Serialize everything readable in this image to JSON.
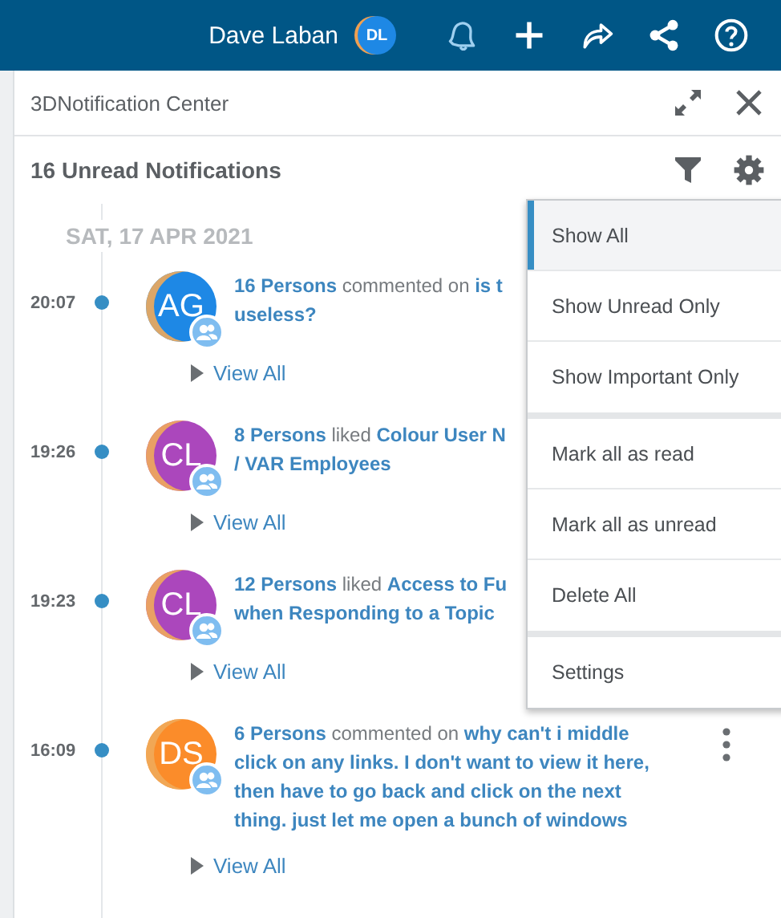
{
  "top_bar": {
    "user_name": "Dave Laban",
    "user_initials": "DL"
  },
  "panel": {
    "title": "3DNotification Center"
  },
  "toolbar": {
    "heading": "16 Unread Notifications"
  },
  "date_heading": "SAT, 17 APR 2021",
  "notifications": [
    {
      "time": "20:07",
      "initials": "AG",
      "color": "#1e88e5",
      "lines": [
        "**16 Persons** commented on **is t**",
        "**useless?**"
      ],
      "view_all": "View All"
    },
    {
      "time": "19:26",
      "initials": "CL",
      "color": "#ab47bc",
      "lines": [
        "**8 Persons** liked **Colour User N**",
        "**/ VAR Employees**"
      ],
      "view_all": "View All"
    },
    {
      "time": "19:23",
      "initials": "CL",
      "color": "#ab47bc",
      "lines": [
        "**12 Persons** liked **Access to Fu**",
        "**when Responding to a Topic**"
      ],
      "view_all": "View All"
    },
    {
      "time": "16:09",
      "initials": "DS",
      "color": "#fb8c2a",
      "lines": [
        "**6 Persons** commented on **why can't i middle**",
        "**click on any links. I don't want to view it here,**",
        "**then have to go back and click on the next**",
        "**thing. just let me open a bunch of windows**"
      ],
      "view_all": "View All",
      "show_more": true
    }
  ],
  "menu": {
    "groups": [
      [
        {
          "label": "Show All",
          "selected": true
        },
        {
          "label": "Show Unread Only",
          "selected": false
        },
        {
          "label": "Show Important Only",
          "selected": false
        }
      ],
      [
        {
          "label": "Mark all as read",
          "selected": false
        },
        {
          "label": "Mark all as unread",
          "selected": false
        },
        {
          "label": "Delete All",
          "selected": false
        }
      ],
      [
        {
          "label": "Settings",
          "selected": false
        }
      ]
    ]
  }
}
